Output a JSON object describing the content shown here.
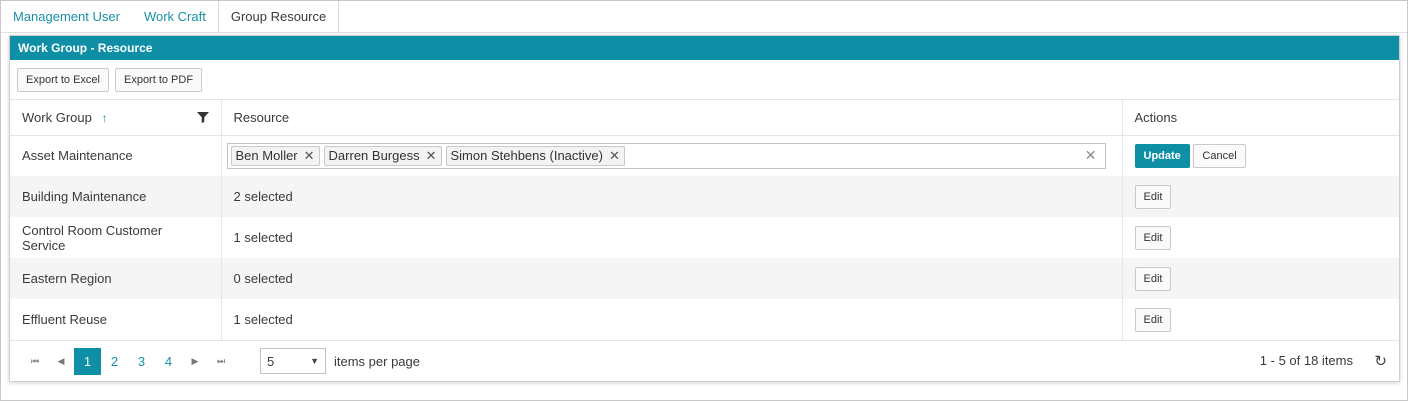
{
  "tabs": [
    "Management User",
    "Work Craft",
    "Group Resource"
  ],
  "panel": {
    "title": "Work Group - Resource",
    "export_excel": "Export to Excel",
    "export_pdf": "Export to PDF"
  },
  "columns": {
    "work_group": "Work Group",
    "resource": "Resource",
    "actions": "Actions"
  },
  "rows": [
    {
      "work_group": "Asset Maintenance",
      "selected_resources": [
        "Ben Moller",
        "Darren Burgess",
        "Simon Stehbens (Inactive)"
      ],
      "update_label": "Update",
      "cancel_label": "Cancel"
    },
    {
      "work_group": "Building Maintenance",
      "resource": "2 selected",
      "edit_label": "Edit"
    },
    {
      "work_group": "Control Room Customer Service",
      "resource": "1 selected",
      "edit_label": "Edit"
    },
    {
      "work_group": "Eastern Region",
      "resource": "0 selected",
      "edit_label": "Edit"
    },
    {
      "work_group": "Effluent Reuse",
      "resource": "1 selected",
      "edit_label": "Edit"
    }
  ],
  "pager": {
    "pages": [
      "1",
      "2",
      "3",
      "4"
    ],
    "current_page": "1",
    "page_size": "5",
    "items_per_page_label": "items per page",
    "info": "1 - 5 of 18 items"
  },
  "colors": {
    "accent": "#0e8fa6",
    "link": "#1a8fa7",
    "alt_row": "#f5f5f5"
  },
  "icons": [
    "sort-ascending-icon",
    "filter-icon",
    "remove-chip-icon",
    "clear-icon",
    "first-page-icon",
    "previous-page-icon",
    "next-page-icon",
    "last-page-icon",
    "dropdown-caret-icon",
    "refresh-icon"
  ]
}
